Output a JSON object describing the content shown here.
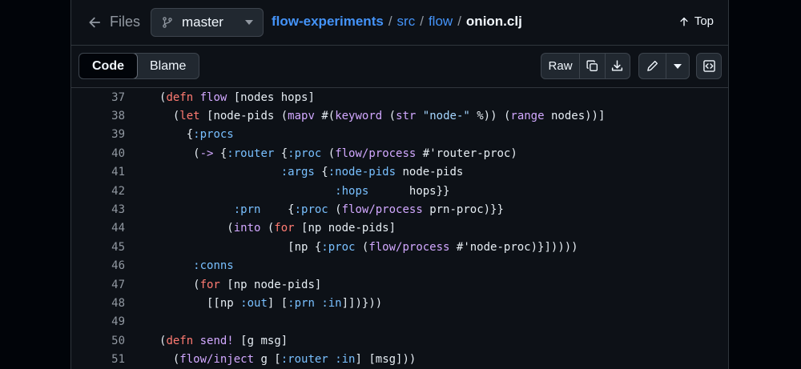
{
  "header": {
    "back_label": "Files",
    "branch": "master",
    "breadcrumb": {
      "repo": "flow-experiments",
      "dir": "src",
      "subdir": "flow",
      "sep": "/",
      "file": "onion.clj"
    },
    "top_label": "Top"
  },
  "toolbar": {
    "code_tab": "Code",
    "blame_tab": "Blame",
    "raw_label": "Raw"
  },
  "colors": {
    "keyword": "#ff7b72",
    "function": "#d2a8ff",
    "constant": "#79c0ff",
    "string": "#a5d6ff",
    "link": "#4493f8"
  },
  "code": {
    "lines": [
      {
        "n": 37,
        "tokens": [
          [
            "",
            "(",
            ""
          ],
          [
            "k",
            "defn"
          ],
          [
            "",
            " "
          ],
          [
            "f",
            "flow"
          ],
          [
            "",
            " [nodes hops]"
          ]
        ]
      },
      {
        "n": 38,
        "tokens": [
          [
            "",
            "  ("
          ],
          [
            "k",
            "let"
          ],
          [
            "",
            " [node-pids ("
          ],
          [
            "f",
            "mapv"
          ],
          [
            "",
            " #("
          ],
          [
            "f",
            "keyword"
          ],
          [
            "",
            " ("
          ],
          [
            "f",
            "str"
          ],
          [
            "",
            " "
          ],
          [
            "s",
            "\"node-\""
          ],
          [
            "",
            " %)) ("
          ],
          [
            "f",
            "range"
          ],
          [
            "",
            " nodes))]"
          ]
        ]
      },
      {
        "n": 39,
        "tokens": [
          [
            "",
            "    {"
          ],
          [
            "c",
            ":procs"
          ]
        ]
      },
      {
        "n": 40,
        "tokens": [
          [
            "",
            "     ("
          ],
          [
            "f",
            "->"
          ],
          [
            "",
            " {"
          ],
          [
            "c",
            ":router"
          ],
          [
            "",
            " {"
          ],
          [
            "c",
            ":proc"
          ],
          [
            "",
            " ("
          ],
          [
            "f",
            "flow/process"
          ],
          [
            "",
            " #'router-proc)"
          ]
        ]
      },
      {
        "n": 41,
        "tokens": [
          [
            "",
            "                  "
          ],
          [
            "c",
            ":args"
          ],
          [
            "",
            " {"
          ],
          [
            "c",
            ":node-pids"
          ],
          [
            "",
            " node-pids"
          ]
        ]
      },
      {
        "n": 42,
        "tokens": [
          [
            "",
            "                          "
          ],
          [
            "c",
            ":hops"
          ],
          [
            "",
            "      hops}}"
          ]
        ]
      },
      {
        "n": 43,
        "tokens": [
          [
            "",
            "           "
          ],
          [
            "c",
            ":prn"
          ],
          [
            "",
            "    {"
          ],
          [
            "c",
            ":proc"
          ],
          [
            "",
            " ("
          ],
          [
            "f",
            "flow/process"
          ],
          [
            "",
            " prn-proc)}}"
          ]
        ]
      },
      {
        "n": 44,
        "tokens": [
          [
            "",
            "          ("
          ],
          [
            "f",
            "into"
          ],
          [
            "",
            " ("
          ],
          [
            "k",
            "for"
          ],
          [
            "",
            " [np node-pids]"
          ]
        ]
      },
      {
        "n": 45,
        "tokens": [
          [
            "",
            "                   [np {"
          ],
          [
            "c",
            ":proc"
          ],
          [
            "",
            " ("
          ],
          [
            "f",
            "flow/process"
          ],
          [
            "",
            " #'node-proc)}]))))"
          ]
        ]
      },
      {
        "n": 46,
        "tokens": [
          [
            "",
            "     "
          ],
          [
            "c",
            ":conns"
          ]
        ]
      },
      {
        "n": 47,
        "tokens": [
          [
            "",
            "     ("
          ],
          [
            "k",
            "for"
          ],
          [
            "",
            " [np node-pids]"
          ]
        ]
      },
      {
        "n": 48,
        "tokens": [
          [
            "",
            "       [[np "
          ],
          [
            "c",
            ":out"
          ],
          [
            "",
            "] ["
          ],
          [
            "c",
            ":prn"
          ],
          [
            "",
            " "
          ],
          [
            "c",
            ":in"
          ],
          [
            "",
            "]])}))"
          ]
        ]
      },
      {
        "n": 49,
        "tokens": []
      },
      {
        "n": 50,
        "tokens": [
          [
            "",
            "("
          ],
          [
            "k",
            "defn"
          ],
          [
            "",
            " "
          ],
          [
            "f",
            "send!"
          ],
          [
            "",
            " [g msg]"
          ]
        ]
      },
      {
        "n": 51,
        "tokens": [
          [
            "",
            "  ("
          ],
          [
            "f",
            "flow/inject"
          ],
          [
            "",
            " g ["
          ],
          [
            "c",
            ":router"
          ],
          [
            "",
            " "
          ],
          [
            "c",
            ":in"
          ],
          [
            "",
            "] [msg]))"
          ]
        ]
      }
    ]
  }
}
